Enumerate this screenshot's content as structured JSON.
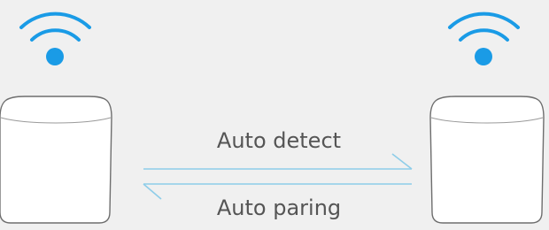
{
  "diagram": {
    "top_label": "Auto detect",
    "bottom_label": "Auto paring"
  },
  "colors": {
    "background": "#f0f0f0",
    "wifi": "#1a9be6",
    "device_fill": "#ffffff",
    "device_stroke": "#6e6e6e",
    "arrow": "#8ecde9",
    "text": "#555555"
  },
  "icons": {
    "left_signal": "wifi-icon",
    "right_signal": "wifi-icon",
    "left_device": "router-node",
    "right_device": "router-node"
  }
}
